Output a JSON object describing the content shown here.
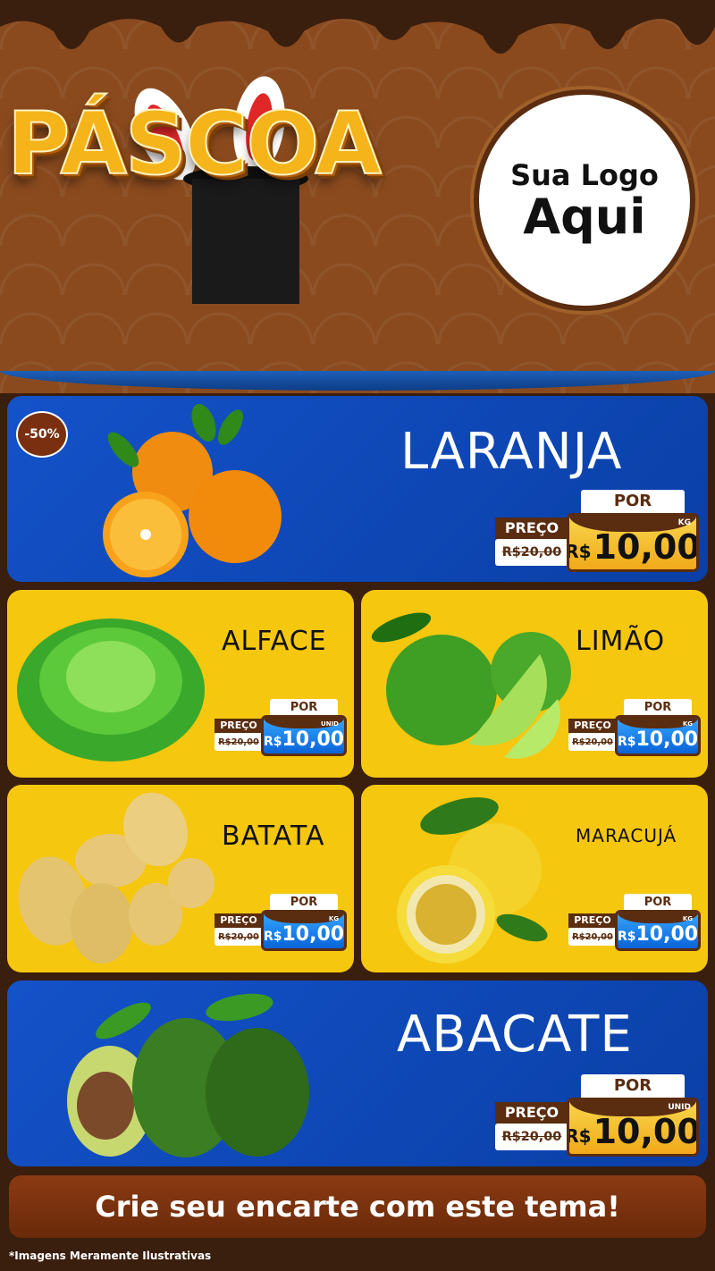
{
  "header": {
    "title": "PÁSCOA",
    "logo_line1": "Sua Logo",
    "logo_line2": "Aqui"
  },
  "badge": "-50%",
  "products": [
    {
      "name": "LARANJA",
      "por": "POR",
      "preco_label": "PREÇO",
      "old_price": "R$20,00",
      "currency": "R$",
      "new_price": "10,00",
      "unit": "KG"
    },
    {
      "name": "ALFACE",
      "por": "POR",
      "preco_label": "PREÇO",
      "old_price": "R$20,00",
      "currency": "R$",
      "new_price": "10,00",
      "unit": "UNID"
    },
    {
      "name": "LIMÃO",
      "por": "POR",
      "preco_label": "PREÇO",
      "old_price": "R$20,00",
      "currency": "R$",
      "new_price": "10,00",
      "unit": "KG"
    },
    {
      "name": "BATATA",
      "por": "POR",
      "preco_label": "PREÇO",
      "old_price": "R$20,00",
      "currency": "R$",
      "new_price": "10,00",
      "unit": "KG"
    },
    {
      "name": "MARACUJÁ",
      "por": "POR",
      "preco_label": "PREÇO",
      "old_price": "R$20,00",
      "currency": "R$",
      "new_price": "10,00",
      "unit": "KG"
    },
    {
      "name": "ABACATE",
      "por": "POR",
      "preco_label": "PREÇO",
      "old_price": "R$20,00",
      "currency": "R$",
      "new_price": "10,00",
      "unit": "UNID"
    }
  ],
  "cta": "Crie seu encarte com este tema!",
  "footer": "*Imagens Meramente Ilustrativas",
  "colors": {
    "brown": "#5a2c10",
    "blue": "#1452c9",
    "yellow": "#f5c70f",
    "gold": "#f4b41a"
  }
}
